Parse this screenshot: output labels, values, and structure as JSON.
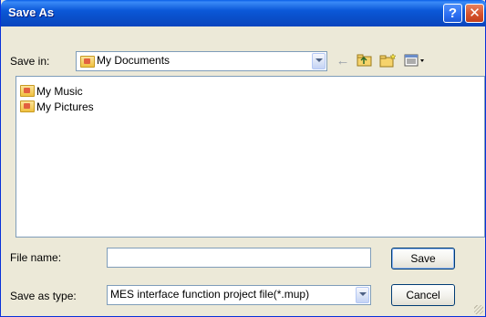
{
  "window": {
    "title": "Save As",
    "help_glyph": "?",
    "close_glyph": "✕"
  },
  "toolbar": {
    "save_in_label": "Save in:",
    "save_in_value": "My Documents",
    "icons": [
      "back-arrow-icon",
      "up-folder-icon",
      "new-folder-icon",
      "view-menu-icon"
    ]
  },
  "file_list": {
    "items": [
      {
        "name": "My Music",
        "icon": "music-folder-icon"
      },
      {
        "name": "My Pictures",
        "icon": "pictures-folder-icon"
      }
    ]
  },
  "form": {
    "file_name_label": "File name:",
    "file_name_value": "",
    "save_as_type_label": "Save as type:",
    "save_as_type_value": "MES interface function project file(*.mup)"
  },
  "buttons": {
    "save_label": "Save",
    "cancel_label": "Cancel"
  }
}
